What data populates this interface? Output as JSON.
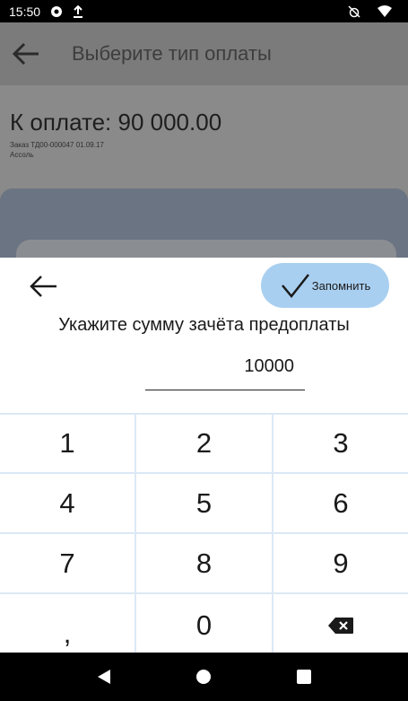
{
  "status_bar": {
    "time": "15:50",
    "icons_left": [
      "gear-notification-icon",
      "upload-icon"
    ],
    "icons_right": [
      "alarm-off-icon",
      "wifi-icon"
    ]
  },
  "background": {
    "title": "Выберите тип оплаты",
    "amount_label": "К оплате: 90 000.00",
    "order_line": "Заказ ТД00-000047 01.09.17",
    "client_line": "Ассоль"
  },
  "sheet": {
    "remember_label": "Запомнить",
    "prompt": "Укажите сумму зачёта предоплаты",
    "amount_value": "10000"
  },
  "keypad": {
    "k1": "1",
    "k2": "2",
    "k3": "3",
    "k4": "4",
    "k5": "5",
    "k6": "6",
    "k7": "7",
    "k8": "8",
    "k9": "9",
    "comma": ",",
    "k0": "0",
    "backspace_icon": "backspace-icon"
  },
  "colors": {
    "accent_button": "#a9cff0",
    "keypad_grid": "#dbe8f5",
    "overlay_dim": "#8a8a8a"
  }
}
